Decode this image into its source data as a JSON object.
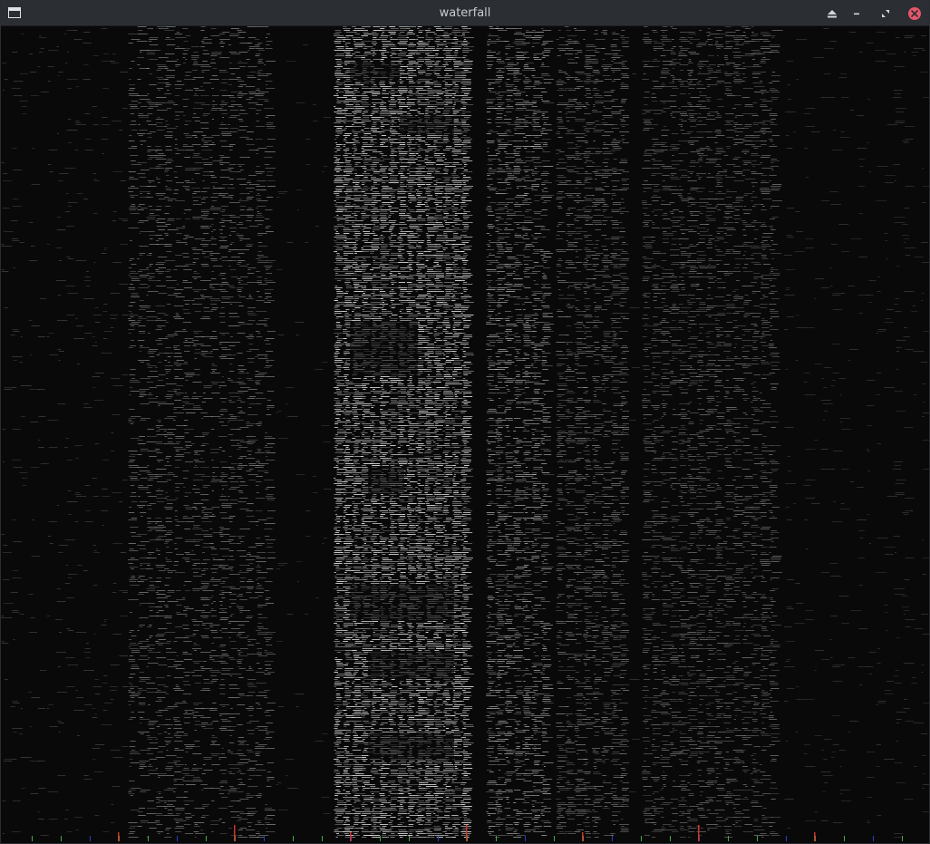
{
  "window": {
    "title": "waterfall",
    "icons": {
      "app": "app-window-icon",
      "shade": "eject-icon",
      "minimize": "minimize-icon",
      "maximize": "maximize-icon",
      "close": "close-icon"
    },
    "colors": {
      "titlebar": "#2b2e33",
      "title_text": "#c7ccd1",
      "close_button": "#e7576a",
      "background": "#090909"
    }
  },
  "waterfall": {
    "signal_color": "#e6e6e6",
    "tick_colors": [
      "#3fae4a",
      "#2f3fc8",
      "#d0342c"
    ]
  }
}
